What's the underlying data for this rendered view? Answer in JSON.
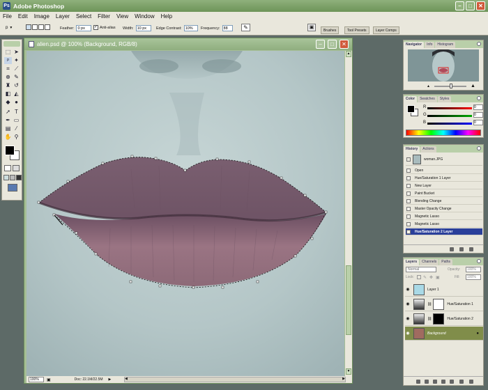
{
  "app": {
    "title": "Adobe Photoshop",
    "logo": "Ps"
  },
  "menu": [
    "File",
    "Edit",
    "Image",
    "Layer",
    "Select",
    "Filter",
    "View",
    "Window",
    "Help"
  ],
  "options": {
    "feather_label": "Feather:",
    "feather_value": "0 px",
    "antialias_label": "Anti-alias",
    "width_label": "Width:",
    "width_value": "10 px",
    "edge_label": "Edge Contrast:",
    "edge_value": "10%",
    "frequency_label": "Frequency:",
    "frequency_value": "88",
    "well_tabs": [
      "Brushes",
      "Tool Presets",
      "Layer Comps"
    ]
  },
  "document": {
    "title": "alien.psd @ 100% (Background, RGB/8)",
    "zoom": "100%",
    "doc_info": "Doc: 22.1M/22.5M"
  },
  "navigator": {
    "tabs": [
      "Navigator",
      "Info",
      "Histogram"
    ]
  },
  "color": {
    "tabs": [
      "Color",
      "Swatches",
      "Styles"
    ],
    "channels": [
      {
        "label": "R",
        "value": "0"
      },
      {
        "label": "G",
        "value": "0"
      },
      {
        "label": "B",
        "value": "0"
      }
    ]
  },
  "history": {
    "tabs": [
      "History",
      "Actions"
    ],
    "snapshot": "woman.JPG",
    "steps": [
      "Open",
      "Hue/Saturation 1 Layer",
      "New Layer",
      "Paint Bucket",
      "Blending Change",
      "Master Opacity Change",
      "Magnetic Lasso",
      "Magnetic Lasso",
      "Hue/Saturation 2 Layer"
    ]
  },
  "layers": {
    "tabs": [
      "Layers",
      "Channels",
      "Paths"
    ],
    "blend_mode": "Normal",
    "opacity_label": "Opacity:",
    "opacity_value": "100%",
    "lock_label": "Lock:",
    "fill_label": "Fill:",
    "fill_value": "100%",
    "items": [
      "Layer 1",
      "Hue/Saturation 1",
      "Hue/Saturation 2",
      "Background"
    ]
  },
  "colors": {
    "titlebar": "#7aa066",
    "accent_selected": "#2a3f9a",
    "layer_selected": "#808d4a",
    "canvas_face": "#b8c9ca",
    "lips": "#8a6a78"
  }
}
